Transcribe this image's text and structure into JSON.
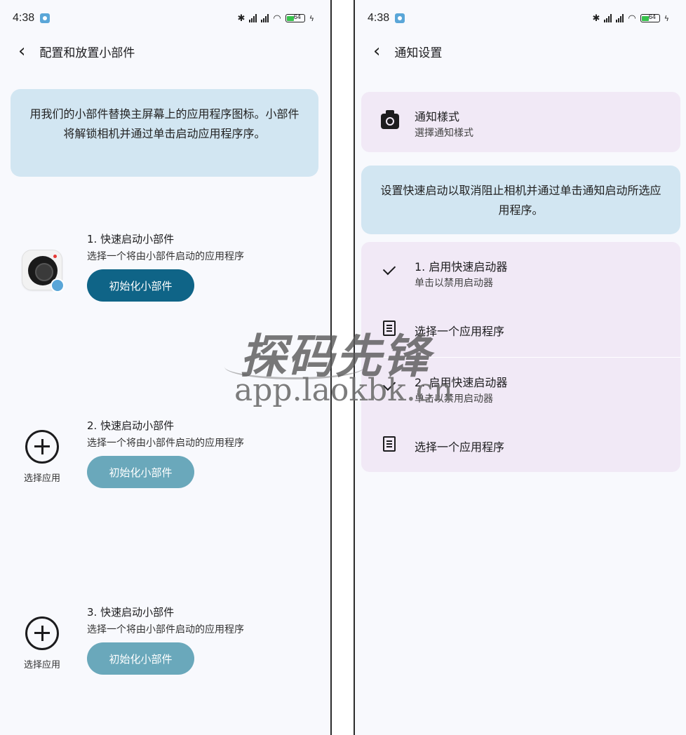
{
  "colors": {
    "banner_bg": "#d2e6f2",
    "card_bg": "#f1e9f6",
    "button_active": "#0f6487",
    "button_disabled": "#6aa8bb"
  },
  "left": {
    "status": {
      "time": "4:38",
      "battery": "64"
    },
    "header": {
      "title": "配置和放置小部件"
    },
    "banner": "用我们的小部件替换主屏幕上的应用程序图标。小部件将解锁相机并通过单击启动应用程序序。",
    "widgets": [
      {
        "title": "1. 快速启动小部件",
        "subtitle": "选择一个将由小部件启动的应用程序",
        "button": "初始化小部件",
        "state": "active"
      },
      {
        "title": "2. 快速启动小部件",
        "subtitle": "选择一个将由小部件启动的应用程序",
        "button": "初始化小部件",
        "pick_label": "选择应用",
        "state": "disabled"
      },
      {
        "title": "3. 快速启动小部件",
        "subtitle": "选择一个将由小部件启动的应用程序",
        "button": "初始化小部件",
        "pick_label": "选择应用",
        "state": "disabled"
      }
    ]
  },
  "right": {
    "status": {
      "time": "4:38",
      "battery": "64"
    },
    "header": {
      "title": "通知设置"
    },
    "notification_style": {
      "title": "通知樣式",
      "subtitle": "選擇通知樣式"
    },
    "banner": "设置快速启动以取消阻止相机并通过单击通知启动所选应用程序。",
    "launcher_rows": [
      {
        "title": "1. 启用快速启动器",
        "subtitle": "单击以禁用启动器",
        "icon": "check-icon"
      },
      {
        "title": "选择一个应用程序",
        "icon": "document-icon"
      },
      {
        "title": "2. 启用快速启动器",
        "subtitle": "单击以禁用启动器",
        "icon": "check-icon"
      },
      {
        "title": "选择一个应用程序",
        "icon": "document-icon"
      }
    ]
  },
  "watermark": {
    "brand": "探码先锋",
    "url": "app.laokbk.cn"
  }
}
